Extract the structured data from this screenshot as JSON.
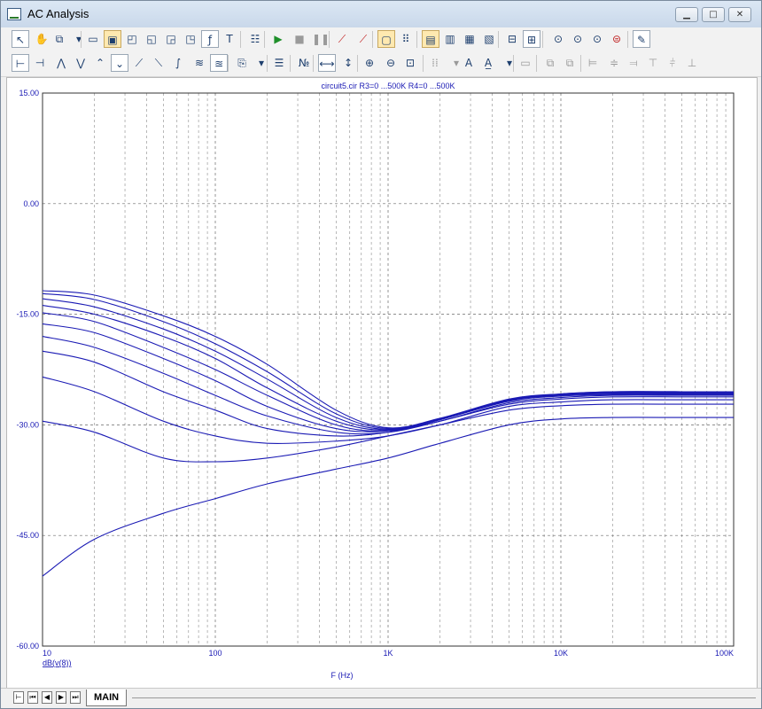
{
  "window": {
    "title": "AC Analysis",
    "controls": {
      "minimize": "▁",
      "maximize": "□",
      "close": "✕"
    }
  },
  "toolbar1": [
    {
      "icon": "pointer-icon",
      "glyph": "↖"
    },
    {
      "icon": "pan-hand-icon",
      "glyph": "✋"
    },
    {
      "icon": "copy-icon",
      "glyph": "⧉"
    },
    {
      "icon": "dropdown-arrow-icon",
      "glyph": "▾"
    },
    {
      "icon": "window-icon",
      "glyph": "▭"
    },
    {
      "icon": "scale-icon",
      "glyph": "▣",
      "state": "pressed"
    },
    {
      "icon": "maximize-plot-icon",
      "glyph": "◰"
    },
    {
      "icon": "plot-option-icon",
      "glyph": "◱"
    },
    {
      "icon": "plot-option-2-icon",
      "glyph": "◲"
    },
    {
      "icon": "plot-option-3-icon",
      "glyph": "◳"
    },
    {
      "icon": "formula-icon",
      "glyph": "ƒ"
    },
    {
      "icon": "text-icon",
      "glyph": "T"
    },
    {
      "icon": "properties-icon",
      "glyph": "☷"
    },
    {
      "icon": "run-icon",
      "glyph": "▶",
      "state": "green"
    },
    {
      "icon": "stop-icon",
      "glyph": "■",
      "state": "gray"
    },
    {
      "icon": "pause-icon",
      "glyph": "❚❚",
      "state": "gray"
    },
    {
      "icon": "cursor-1-icon",
      "glyph": "⟋",
      "state": "red"
    },
    {
      "icon": "cursor-2-icon",
      "glyph": "⟋",
      "state": "red"
    },
    {
      "icon": "grid-on-icon",
      "glyph": "▢",
      "state": "pressed"
    },
    {
      "icon": "grid-dots-icon",
      "glyph": "⠿"
    },
    {
      "icon": "layout-1-icon",
      "glyph": "▤",
      "state": "pressed"
    },
    {
      "icon": "layout-2-icon",
      "glyph": "▥"
    },
    {
      "icon": "layout-3-icon",
      "glyph": "▦"
    },
    {
      "icon": "layout-4-icon",
      "glyph": "▧"
    },
    {
      "icon": "split-horizontal-icon",
      "glyph": "⊟"
    },
    {
      "icon": "split-grid-icon",
      "glyph": "⊞"
    },
    {
      "icon": "zoom-fit-icon",
      "glyph": "⊙"
    },
    {
      "icon": "zoom-y-icon",
      "glyph": "⊙"
    },
    {
      "icon": "zoom-x-icon",
      "glyph": "⊙"
    },
    {
      "icon": "zoom-all-icon",
      "glyph": "⊜",
      "state": "red"
    },
    {
      "icon": "settings-icon",
      "glyph": "✎"
    }
  ],
  "toolbar2": [
    {
      "icon": "cursor-mode-1-icon",
      "glyph": "⊢"
    },
    {
      "icon": "cursor-mode-2-icon",
      "glyph": "⊣"
    },
    {
      "icon": "peak-icon",
      "glyph": "⋀"
    },
    {
      "icon": "valley-icon",
      "glyph": "⋁"
    },
    {
      "icon": "high-icon",
      "glyph": "⌃"
    },
    {
      "icon": "low-icon",
      "glyph": "⌄"
    },
    {
      "icon": "slope-icon",
      "glyph": "⟋"
    },
    {
      "icon": "next-icon",
      "glyph": "⟍"
    },
    {
      "icon": "inflection-icon",
      "glyph": "∫"
    },
    {
      "icon": "global-high-icon",
      "glyph": "≋"
    },
    {
      "icon": "global-low-icon",
      "glyph": "≊"
    },
    {
      "icon": "paste-icon",
      "glyph": "⎘"
    },
    {
      "icon": "dropdown-arrow-2-icon",
      "glyph": "▾"
    },
    {
      "icon": "list-icon",
      "glyph": "☰"
    },
    {
      "icon": "numeric-icon",
      "glyph": "№"
    },
    {
      "icon": "fit-x-icon",
      "glyph": "⟷"
    },
    {
      "icon": "fit-y-icon",
      "glyph": "↕"
    },
    {
      "icon": "zoom-in-icon",
      "glyph": "⊕"
    },
    {
      "icon": "zoom-out-icon",
      "glyph": "⊖"
    },
    {
      "icon": "zoom-window-icon",
      "glyph": "⊡"
    },
    {
      "icon": "grid-style-icon",
      "glyph": "⁞⁞",
      "state": "gray"
    },
    {
      "icon": "dropdown-arrow-3-icon",
      "glyph": "▾",
      "state": "gray"
    },
    {
      "icon": "font-icon",
      "glyph": "A"
    },
    {
      "icon": "font-style-icon",
      "glyph": "A̲"
    },
    {
      "icon": "dropdown-arrow-4-icon",
      "glyph": "▾"
    },
    {
      "icon": "align-1-icon",
      "glyph": "▭",
      "state": "gray"
    },
    {
      "icon": "align-2-icon",
      "glyph": "⧉",
      "state": "gray"
    },
    {
      "icon": "align-3-icon",
      "glyph": "⧉",
      "state": "gray"
    },
    {
      "icon": "align-left-icon",
      "glyph": "⊨",
      "state": "gray"
    },
    {
      "icon": "align-center-icon",
      "glyph": "≑",
      "state": "gray"
    },
    {
      "icon": "align-right-icon",
      "glyph": "⫤",
      "state": "gray"
    },
    {
      "icon": "align-top-icon",
      "glyph": "⊤",
      "state": "gray"
    },
    {
      "icon": "align-middle-icon",
      "glyph": "⫩",
      "state": "gray"
    },
    {
      "icon": "align-bottom-icon",
      "glyph": "⊥",
      "state": "gray"
    }
  ],
  "plot": {
    "title": "circuit5.cir R3=0 ...500K R4=0 ...500K",
    "curve_color": "#1a1ab4",
    "label_color": "#1a1ab4"
  },
  "tabs": {
    "main": "MAIN",
    "nav": [
      "⊢",
      "⏮",
      "◀",
      "▶",
      "⏭"
    ]
  },
  "chart_data": {
    "type": "line",
    "title": "circuit5.cir R3=0 ...500K R4=0 ...500K",
    "xlabel": "F (Hz)",
    "ylabel": "dB(v(8))",
    "xscale": "log",
    "xlim": [
      10,
      100000
    ],
    "ylim": [
      -60,
      15
    ],
    "xticks": [
      "10",
      "100",
      "1K",
      "10K",
      "100K"
    ],
    "yticks": [
      "15.00",
      "0.00",
      "-15.00",
      "-30.00",
      "-45.00",
      "-60.00"
    ],
    "grid": true,
    "x": [
      10,
      20,
      50,
      100,
      200,
      500,
      1000,
      2000,
      5000,
      10000,
      20000,
      50000,
      100000
    ],
    "series": [
      {
        "values": [
          -50.5,
          -45.5,
          -42.0,
          -40.0,
          -38.0,
          -36.0,
          -34.5,
          -32.5,
          -30.0,
          -29.2,
          -29.0,
          -29.0,
          -29.0
        ]
      },
      {
        "values": [
          -29.5,
          -31.0,
          -34.5,
          -35.0,
          -34.5,
          -33.0,
          -31.5,
          -30.0,
          -28.0,
          -27.4,
          -27.2,
          -27.2,
          -27.2
        ]
      },
      {
        "values": [
          -23.5,
          -25.5,
          -29.5,
          -31.5,
          -32.5,
          -32.2,
          -31.5,
          -30.0,
          -27.5,
          -26.9,
          -26.6,
          -26.6,
          -26.6
        ]
      },
      {
        "values": [
          -20.0,
          -21.5,
          -25.5,
          -28.0,
          -30.5,
          -31.5,
          -31.0,
          -29.5,
          -27.2,
          -26.5,
          -26.2,
          -26.2,
          -26.2
        ]
      },
      {
        "values": [
          -18.0,
          -19.5,
          -23.0,
          -26.0,
          -28.8,
          -31.0,
          -31.0,
          -29.5,
          -27.0,
          -26.3,
          -26.0,
          -26.0,
          -26.0
        ]
      },
      {
        "values": [
          -16.3,
          -17.5,
          -21.0,
          -24.0,
          -27.5,
          -30.5,
          -30.8,
          -29.3,
          -26.8,
          -26.1,
          -25.9,
          -25.9,
          -25.9
        ]
      },
      {
        "values": [
          -14.8,
          -16.0,
          -19.5,
          -22.5,
          -26.0,
          -30.0,
          -30.8,
          -29.3,
          -26.7,
          -26.0,
          -25.8,
          -25.8,
          -25.8
        ]
      },
      {
        "values": [
          -13.8,
          -15.0,
          -18.0,
          -21.0,
          -25.0,
          -29.5,
          -30.7,
          -29.2,
          -26.7,
          -25.9,
          -25.7,
          -25.7,
          -25.7
        ]
      },
      {
        "values": [
          -12.9,
          -14.0,
          -17.0,
          -20.0,
          -23.8,
          -29.0,
          -30.6,
          -29.2,
          -26.6,
          -25.9,
          -25.6,
          -25.6,
          -25.6
        ]
      },
      {
        "values": [
          -12.2,
          -13.0,
          -16.0,
          -19.0,
          -22.8,
          -28.5,
          -30.5,
          -29.2,
          -26.6,
          -25.8,
          -25.5,
          -25.5,
          -25.5
        ]
      },
      {
        "values": [
          -11.8,
          -12.4,
          -15.2,
          -18.0,
          -21.8,
          -28.0,
          -30.4,
          -29.1,
          -26.5,
          -25.8,
          -25.5,
          -25.5,
          -25.5
        ]
      }
    ]
  }
}
